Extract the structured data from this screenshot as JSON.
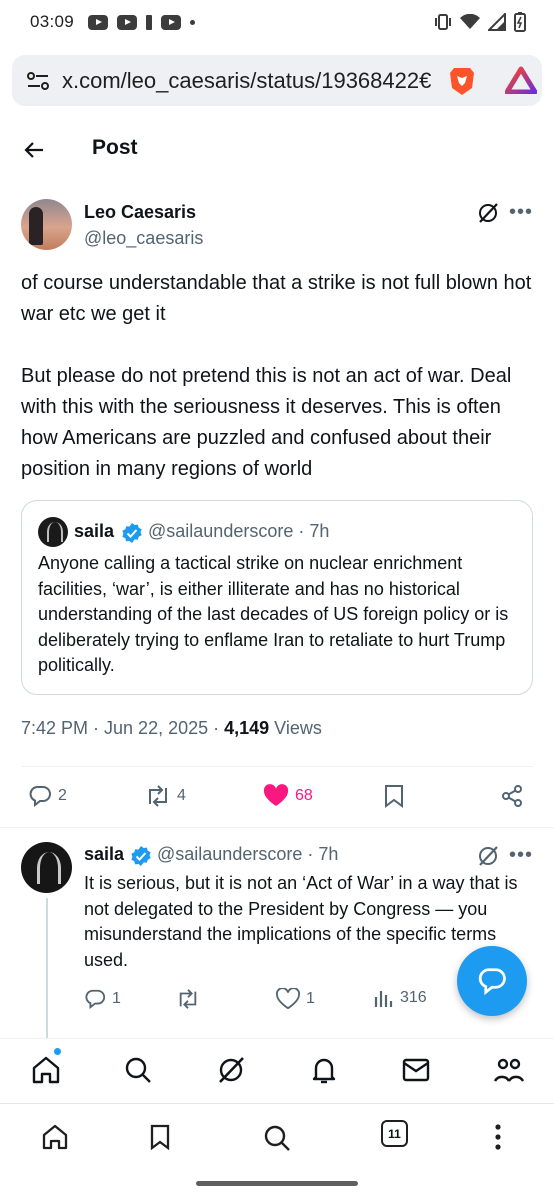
{
  "status_bar": {
    "time": "03:09"
  },
  "browser": {
    "url": "x.com/leo_caesaris/status/19368422€",
    "tab_count": "11"
  },
  "header": {
    "title": "Post"
  },
  "post": {
    "author_name": "Leo Caesaris",
    "author_handle": "@leo_caesaris",
    "paragraphs": [
      "of course understandable that a strike is not full blown hot war etc we get it",
      "But please do not pretend this is not an act of war. Deal with this with the seriousness it deserves. This is often how Americans are puzzled and confused about their position in many regions of world"
    ],
    "quote": {
      "name": "saila",
      "handle_time": "@sailaunderscore · 7h",
      "text": "Anyone calling a tactical strike on nuclear enrichment facilities, ‘war’, is either illiterate and has no historical understanding of the last decades of US foreign policy or is deliberately trying to enflame Iran to retaliate to hurt Trump politically."
    },
    "time_date": "7:42 PM · Jun 22, 2025 · ",
    "views_count": "4,149",
    "views_label": " Views",
    "replies": "2",
    "reposts": "4",
    "likes": "68"
  },
  "reply": {
    "name": "saila",
    "handle_time": "@sailaunderscore · 7h",
    "text": "It is serious, but it is not an ‘Act of War’ in a way that is not delegated to the President by Congress — you misunderstand the implications of the specific terms used.",
    "replies": "1",
    "likes": "1",
    "views": "316"
  },
  "colors": {
    "accent": "#1d9bf0",
    "like": "#f91880",
    "secondary_text": "#536471"
  }
}
